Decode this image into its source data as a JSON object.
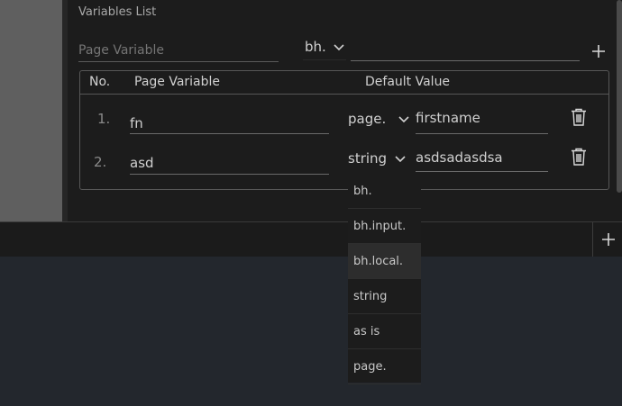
{
  "section_title": "Variables List",
  "add_form": {
    "variable_placeholder": "Page Variable",
    "scope_value": "bh.",
    "value_field": ""
  },
  "table": {
    "columns": [
      "No.",
      "Page Variable",
      "Default Value"
    ],
    "rows": [
      {
        "no": "1.",
        "variable": "fn",
        "scope": "page.",
        "default": "firstname"
      },
      {
        "no": "2.",
        "variable": "asd",
        "scope": "string",
        "default": "asdsadasdsa"
      }
    ]
  },
  "dropdown_options": [
    "bh.",
    "bh.input.",
    "bh.local.",
    "string",
    "as is",
    "page."
  ],
  "dropdown_highlighted": "bh.local.",
  "icons": {
    "add": "plus-icon",
    "delete": "trash-icon",
    "chevron": "chevron-down-icon"
  }
}
